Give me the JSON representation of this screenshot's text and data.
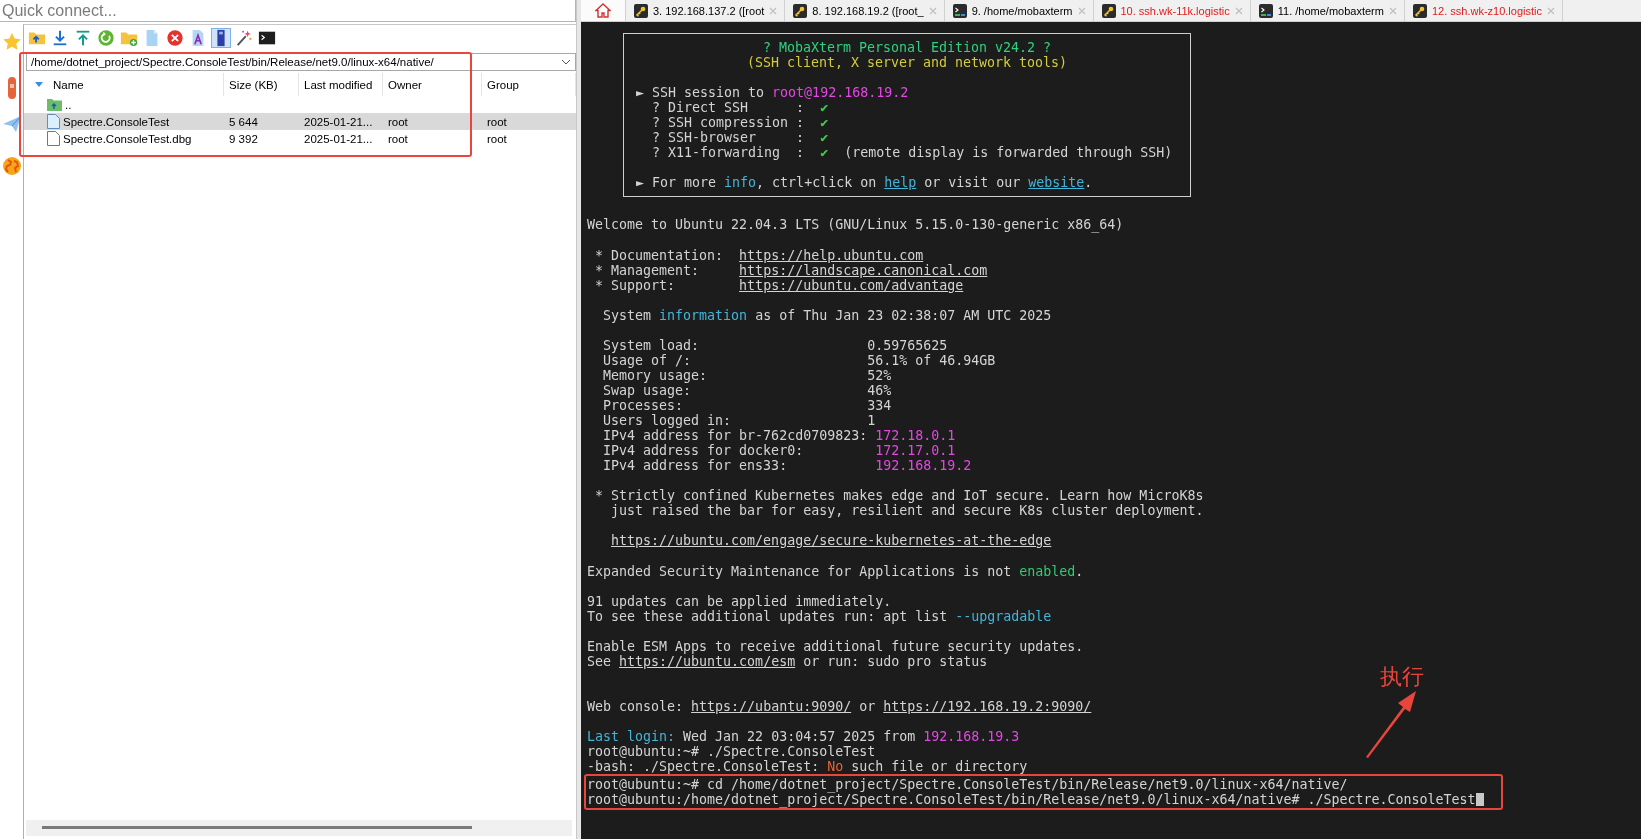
{
  "quick_connect": {
    "placeholder": "Quick connect..."
  },
  "file_browser": {
    "highlighted": true,
    "toolbar": [
      {
        "selected": false
      },
      {
        "selected": false
      },
      {
        "selected": false
      },
      {
        "selected": false
      },
      {
        "selected": false
      },
      {
        "selected": false
      },
      {
        "selected": false
      },
      {
        "selected": false
      },
      {
        "selected": true
      },
      {
        "selected": false
      },
      {
        "selected": false
      }
    ],
    "path": "/home/dotnet_project/Spectre.ConsoleTest/bin/Release/net9.0/linux-x64/native/",
    "columns": [
      "Name",
      "Size (KB)",
      "Last modified",
      "Owner",
      "Group"
    ],
    "rows": [
      {
        "kind": "parent",
        "name": "..",
        "selected": false
      },
      {
        "kind": "executable",
        "name": "Spectre.ConsoleTest",
        "size": "5 644",
        "modified": "2025-01-21...",
        "owner": "root",
        "group": "root",
        "selected": true
      },
      {
        "kind": "file",
        "name": "Spectre.ConsoleTest.dbg",
        "size": "9 392",
        "modified": "2025-01-21...",
        "owner": "root",
        "group": "root",
        "selected": false
      }
    ]
  },
  "tabs": [
    {
      "kind": "home"
    },
    {
      "kind": "ssh",
      "label": "3. 192.168.137.2 ([root"
    },
    {
      "kind": "ssh",
      "label": "8. 192.168.19.2 ([root_"
    },
    {
      "kind": "shell",
      "label": "9. /home/mobaxterm"
    },
    {
      "kind": "ssh",
      "label": "10. ssh.wk-11k.logistic",
      "color": "#e01b1b"
    },
    {
      "kind": "shell",
      "label": "11. /home/mobaxterm"
    },
    {
      "kind": "ssh",
      "label": "12. ssh.wk-z10.logistic",
      "color": "#e01b1b"
    }
  ],
  "terminal": {
    "banner": {
      "title": "? MobaXterm Personal Edition v24.2 ?",
      "subtitle": "(SSH client, X server and network tools)",
      "lines": [
        {
          "kind": "line",
          "segments": [
            {
              "kind": "text",
              "text": "► SSH session to "
            },
            {
              "kind": "address",
              "text": "root@192.168.19.2"
            }
          ]
        },
        {
          "kind": "line",
          "segments": [
            {
              "kind": "text",
              "text": "  ? Direct SSH      :  "
            },
            {
              "kind": "check",
              "text": "✔"
            }
          ]
        },
        {
          "kind": "line",
          "segments": [
            {
              "kind": "text",
              "text": "  ? SSH compression :  "
            },
            {
              "kind": "check",
              "text": "✔"
            }
          ]
        },
        {
          "kind": "line",
          "segments": [
            {
              "kind": "text",
              "text": "  ? SSH-browser     :  "
            },
            {
              "kind": "check",
              "text": "✔"
            }
          ]
        },
        {
          "kind": "line",
          "segments": [
            {
              "kind": "text",
              "text": "  ? X11-forwarding  :  "
            },
            {
              "kind": "check",
              "text": "✔"
            },
            {
              "kind": "text",
              "text": "  (remote display is forwarded through SSH)"
            }
          ]
        },
        {
          "kind": "blank"
        },
        {
          "kind": "line",
          "segments": [
            {
              "kind": "text",
              "text": "► For more "
            },
            {
              "kind": "info",
              "text": "info"
            },
            {
              "kind": "text",
              "text": ", ctrl+click on "
            },
            {
              "kind": "info_link",
              "text": "help"
            },
            {
              "kind": "text",
              "text": " or visit our "
            },
            {
              "kind": "info_link",
              "text": "website"
            },
            {
              "kind": "text",
              "text": "."
            }
          ]
        }
      ]
    },
    "lines": [
      {
        "kind": "line",
        "segments": [
          {
            "kind": "text",
            "text": "Welcome to Ubuntu 22.04.3 LTS (GNU/Linux 5.15.0-130-generic x86_64)"
          }
        ]
      },
      {
        "kind": "blank"
      },
      {
        "kind": "line",
        "segments": [
          {
            "kind": "text",
            "text": " * Documentation:  "
          },
          {
            "kind": "link",
            "text": "https://help.ubuntu.com"
          }
        ]
      },
      {
        "kind": "line",
        "segments": [
          {
            "kind": "text",
            "text": " * Management:     "
          },
          {
            "kind": "link",
            "text": "https://landscape.canonical.com"
          }
        ]
      },
      {
        "kind": "line",
        "segments": [
          {
            "kind": "text",
            "text": " * Support:        "
          },
          {
            "kind": "link",
            "text": "https://ubuntu.com/advantage"
          }
        ]
      },
      {
        "kind": "blank"
      },
      {
        "kind": "line",
        "segments": [
          {
            "kind": "text",
            "text": "  System "
          },
          {
            "kind": "info",
            "text": "information"
          },
          {
            "kind": "text",
            "text": " as of Thu Jan 23 02:38:07 AM UTC 2025"
          }
        ]
      },
      {
        "kind": "blank"
      },
      {
        "kind": "line",
        "segments": [
          {
            "kind": "text",
            "text": "  System load:                     0.59765625"
          }
        ]
      },
      {
        "kind": "line",
        "segments": [
          {
            "kind": "text",
            "text": "  Usage of /:                      56.1% of 46.94GB"
          }
        ]
      },
      {
        "kind": "line",
        "segments": [
          {
            "kind": "text",
            "text": "  Memory usage:                    52%"
          }
        ]
      },
      {
        "kind": "line",
        "segments": [
          {
            "kind": "text",
            "text": "  Swap usage:                      46%"
          }
        ]
      },
      {
        "kind": "line",
        "segments": [
          {
            "kind": "text",
            "text": "  Processes:                       334"
          }
        ]
      },
      {
        "kind": "line",
        "segments": [
          {
            "kind": "text",
            "text": "  Users logged in:                 1"
          }
        ]
      },
      {
        "kind": "line",
        "segments": [
          {
            "kind": "text",
            "text": "  IPv4 address for br-762cd0709823: "
          },
          {
            "kind": "address",
            "text": "172.18.0.1"
          }
        ]
      },
      {
        "kind": "line",
        "segments": [
          {
            "kind": "text",
            "text": "  IPv4 address for docker0:         "
          },
          {
            "kind": "address",
            "text": "172.17.0.1"
          }
        ]
      },
      {
        "kind": "line",
        "segments": [
          {
            "kind": "text",
            "text": "  IPv4 address for ens33:           "
          },
          {
            "kind": "address",
            "text": "192.168.19.2"
          }
        ]
      },
      {
        "kind": "blank"
      },
      {
        "kind": "line",
        "segments": [
          {
            "kind": "text",
            "text": " * Strictly confined Kubernetes makes edge and IoT secure. Learn how MicroK8s"
          }
        ]
      },
      {
        "kind": "line",
        "segments": [
          {
            "kind": "text",
            "text": "   just raised the bar for easy, resilient and secure K8s cluster deployment."
          }
        ]
      },
      {
        "kind": "blank"
      },
      {
        "kind": "line",
        "indent": true,
        "segments": [
          {
            "kind": "link",
            "text": "https://ubuntu.com/engage/secure-kubernetes-at-the-edge"
          }
        ]
      },
      {
        "kind": "blank"
      },
      {
        "kind": "line",
        "segments": [
          {
            "kind": "text",
            "text": "Expanded Security Maintenance for Applications is not "
          },
          {
            "kind": "ok",
            "text": "enabled"
          },
          {
            "kind": "text",
            "text": "."
          }
        ]
      },
      {
        "kind": "blank"
      },
      {
        "kind": "line",
        "segments": [
          {
            "kind": "text",
            "text": "91 updates can be applied immediately."
          }
        ]
      },
      {
        "kind": "line",
        "segments": [
          {
            "kind": "text",
            "text": "To see these additional updates run: apt list "
          },
          {
            "kind": "info",
            "text": "--upgradable"
          }
        ]
      },
      {
        "kind": "blank"
      },
      {
        "kind": "line",
        "segments": [
          {
            "kind": "text",
            "text": "Enable ESM Apps to receive additional future security updates."
          }
        ]
      },
      {
        "kind": "line",
        "segments": [
          {
            "kind": "text",
            "text": "See "
          },
          {
            "kind": "link",
            "text": "https://ubuntu.com/esm"
          },
          {
            "kind": "text",
            "text": " or run: sudo pro status"
          }
        ]
      },
      {
        "kind": "blank"
      },
      {
        "kind": "blank"
      },
      {
        "kind": "line",
        "segments": [
          {
            "kind": "text",
            "text": "Web console: "
          },
          {
            "kind": "link",
            "text": "https://ubantu:9090/"
          },
          {
            "kind": "text",
            "text": " or "
          },
          {
            "kind": "link",
            "text": "https://192.168.19.2:9090/"
          }
        ]
      },
      {
        "kind": "blank"
      },
      {
        "kind": "line",
        "segments": [
          {
            "kind": "info",
            "text": "Last login:"
          },
          {
            "kind": "text",
            "text": " Wed Jan 22 03:04:57 2025 from "
          },
          {
            "kind": "address",
            "text": "192.168.19.3"
          }
        ]
      },
      {
        "kind": "line",
        "segments": [
          {
            "kind": "text",
            "text": "root@ubuntu:~# ./Spectre.ConsoleTest"
          }
        ]
      },
      {
        "kind": "line",
        "segments": [
          {
            "kind": "text",
            "text": "-bash: ./Spectre.ConsoleTest: "
          },
          {
            "kind": "error",
            "text": "No"
          },
          {
            "kind": "text",
            "text": " such file or directory"
          }
        ]
      }
    ],
    "marked_lines": [
      {
        "kind": "line",
        "cursor": false,
        "segments": [
          {
            "kind": "text",
            "text": "root@ubuntu:~# cd /home/dotnet_project/Spectre.ConsoleTest/bin/Release/net9.0/linux-x64/native/"
          }
        ]
      },
      {
        "kind": "line",
        "cursor": true,
        "segments": [
          {
            "kind": "text",
            "text": "root@ubuntu:/home/dotnet_project/Spectre.ConsoleTest/bin/Release/net9.0/linux-x64/native# ./Spectre.ConsoleTest"
          }
        ]
      }
    ]
  },
  "callout": {
    "text": "执行"
  }
}
